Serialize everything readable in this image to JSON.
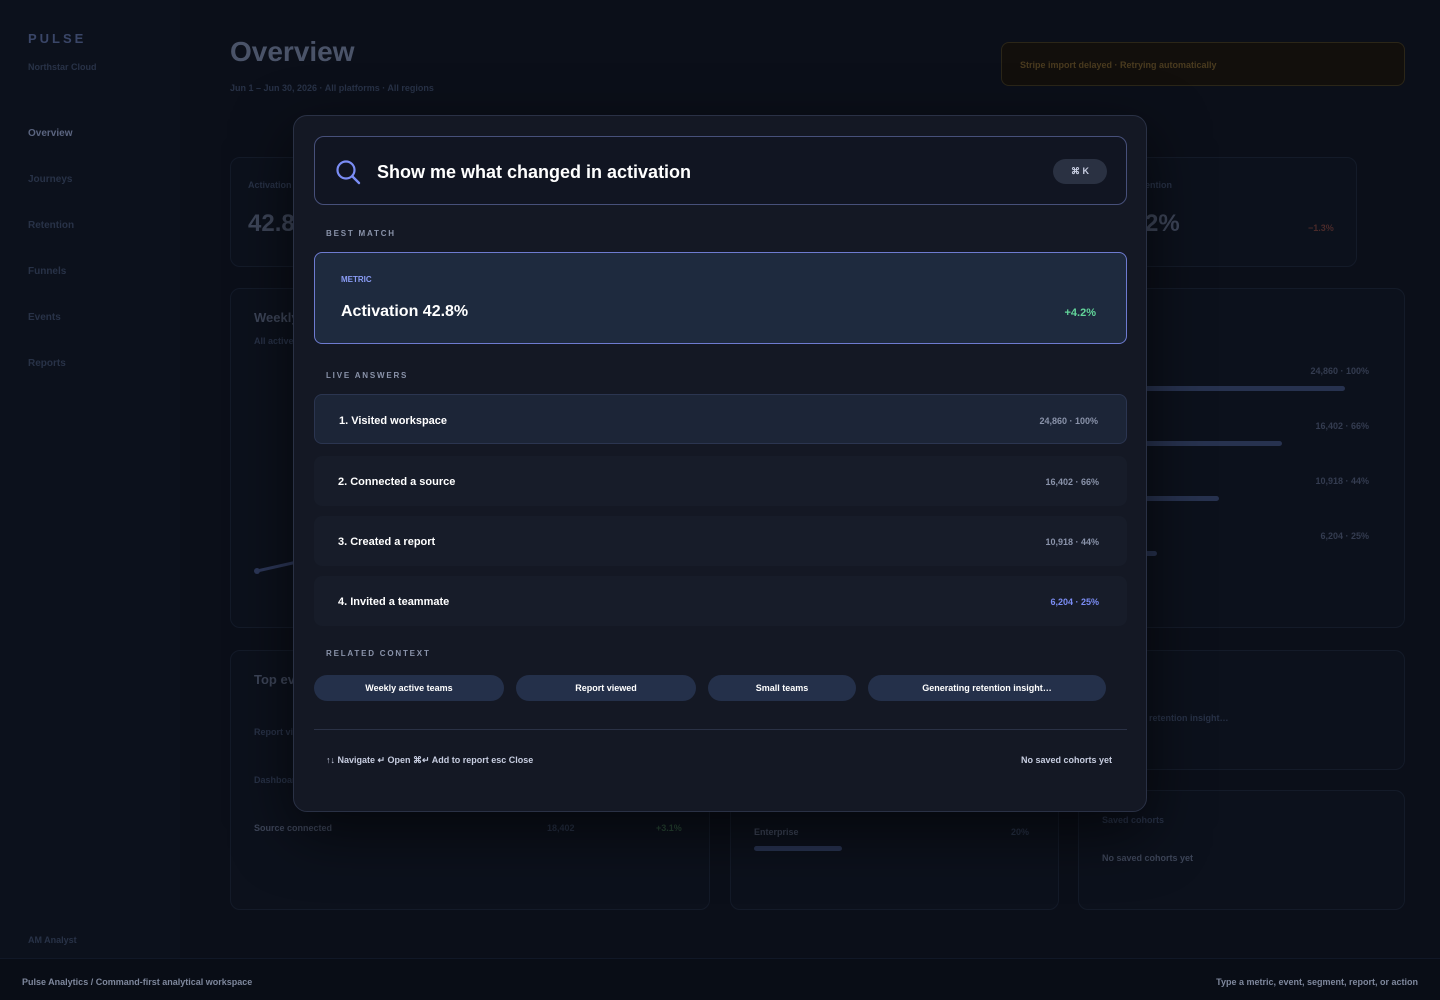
{
  "app": {
    "brand": "PULSE",
    "org": "Northstar Cloud",
    "user": "AM Analyst"
  },
  "nav": {
    "items": [
      "Overview",
      "Journeys",
      "Retention",
      "Funnels",
      "Events",
      "Reports"
    ]
  },
  "header": {
    "title": "Overview",
    "subtitle": "Jun 1 – Jun 30, 2026 · All platforms · All regions"
  },
  "banner": {
    "text": "Stripe import delayed · Retrying automatically"
  },
  "background": {
    "kpi_activation_label": "Activation",
    "kpi_activation_value": "42.8",
    "kpi_retention_label": "ention",
    "kpi_retention_value": "2%",
    "kpi_retention_delta": "−1.3%",
    "weekly_title": "Weekly",
    "weekly_sub": "All active",
    "funnel_values": [
      "24,860 · 100%",
      "16,402 · 66%",
      "10,918 · 44%",
      "6,204 · 25%"
    ],
    "top_events_title": "Top eve",
    "top_events": [
      {
        "name": "Report vi",
        "count": "",
        "delta": ""
      },
      {
        "name": "Dashboar",
        "count": "",
        "delta": ""
      },
      {
        "name": "Source connected",
        "count": "18,402",
        "delta": "+3.1%"
      }
    ],
    "segment_name": "Enterprise",
    "segment_pct": "20%",
    "insight_text": "g retention insight…",
    "saved_cohorts_title": "Saved cohorts",
    "saved_cohorts_empty": "No saved cohorts yet"
  },
  "palette": {
    "query": "Show me what changed in activation",
    "shortcut": "⌘ K",
    "best_match_label": "BEST MATCH",
    "best_match": {
      "tag": "METRIC",
      "name": "Activation 42.8%",
      "delta": "+4.2%"
    },
    "live_answers_label": "LIVE ANSWERS",
    "live_answers": [
      {
        "label": "1. Visited workspace",
        "value": "24,860 · 100%"
      },
      {
        "label": "2. Connected a source",
        "value": "16,402 · 66%"
      },
      {
        "label": "3. Created a report",
        "value": "10,918 · 44%"
      },
      {
        "label": "4. Invited a teammate",
        "value": "6,204 · 25%"
      }
    ],
    "related_label": "RELATED CONTEXT",
    "related_chips": [
      "Weekly active teams",
      "Report viewed",
      "Small teams",
      "Generating retention insight…"
    ],
    "footer_hints": "↑↓ Navigate ↵ Open ⌘↵ Add to report esc Close",
    "footer_right": "No saved cohorts yet"
  },
  "statusbar": {
    "left": "Pulse Analytics / Command-first analytical workspace",
    "right": "Type a metric, event, segment, report, or action"
  },
  "colors": {
    "accent": "#7b8df5",
    "positive": "#62d59a",
    "chip": "#24304a"
  }
}
